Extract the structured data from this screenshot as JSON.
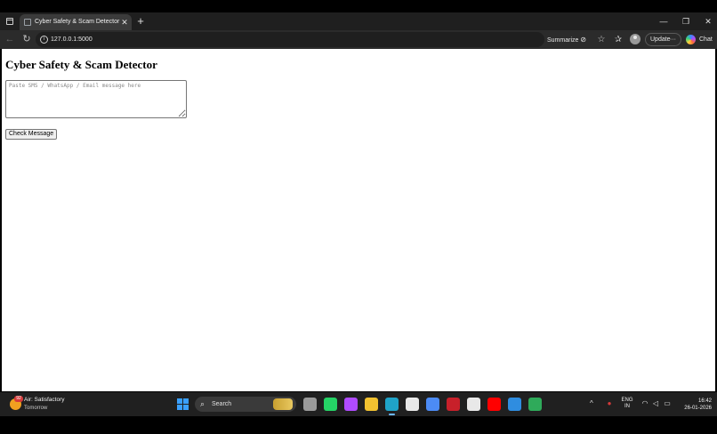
{
  "browser": {
    "tab_title": "Cyber Safety & Scam Detector",
    "url": "127.0.0.1:5000",
    "summarize_label": "Summarize",
    "update_label": "Update",
    "update_more": "···",
    "chat_label": "Chat"
  },
  "page": {
    "title": "Cyber Safety & Scam Detector",
    "input_placeholder": "Paste SMS / WhatsApp / Email message here",
    "input_value": "",
    "check_button_label": "Check Message"
  },
  "taskbar": {
    "weather_title": "Air: Satisfactory",
    "weather_subtitle": "Tomorrow",
    "weather_badge": "92",
    "search_label": "Search",
    "language_line1": "ENG",
    "language_line2": "IN",
    "time": "16:42",
    "date": "26-01-2026",
    "apps": [
      {
        "name": "task-view-icon",
        "color": "#9a9a9a"
      },
      {
        "name": "whatsapp-icon",
        "color": "#25d366"
      },
      {
        "name": "copilot-app-icon",
        "color": "#b04bff"
      },
      {
        "name": "file-explorer-icon",
        "color": "#f2c230"
      },
      {
        "name": "edge-icon",
        "color": "#1fa3c8"
      },
      {
        "name": "store-icon",
        "color": "#e8e8e8"
      },
      {
        "name": "chrome-icon",
        "color": "#4c8bf5"
      },
      {
        "name": "mcafee-icon",
        "color": "#c8202a"
      },
      {
        "name": "chatgpt-icon",
        "color": "#e8e8e8"
      },
      {
        "name": "youtube-icon",
        "color": "#ff0000"
      },
      {
        "name": "vscode-icon",
        "color": "#2f8de0"
      },
      {
        "name": "chrome-dev-icon",
        "color": "#2faa5a"
      }
    ]
  }
}
